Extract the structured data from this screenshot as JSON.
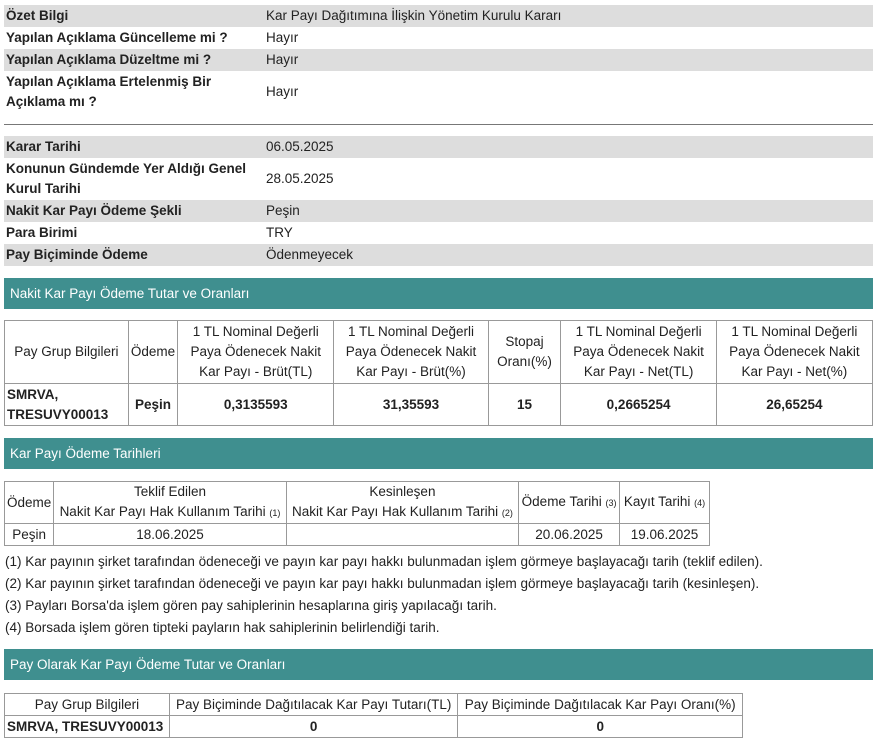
{
  "summary": [
    {
      "key": "Özet Bilgi",
      "value": "Kar Payı Dağıtımına İlişkin Yönetim Kurulu Kararı"
    },
    {
      "key": "Yapılan Açıklama Güncelleme mi ?",
      "value": "Hayır"
    },
    {
      "key": "Yapılan Açıklama Düzeltme mi ?",
      "value": "Hayır"
    },
    {
      "key": "Yapılan Açıklama Ertelenmiş Bir Açıklama mı ?",
      "value": "Hayır"
    }
  ],
  "details": [
    {
      "key": "Karar Tarihi",
      "value": "06.05.2025"
    },
    {
      "key": "Konunun Gündemde Yer Aldığı Genel Kurul Tarihi",
      "value": "28.05.2025"
    },
    {
      "key": "Nakit Kar Payı Ödeme Şekli",
      "value": "Peşin"
    },
    {
      "key": "Para Birimi",
      "value": "TRY"
    },
    {
      "key": "Pay Biçiminde Ödeme",
      "value": "Ödenmeyecek"
    }
  ],
  "cash_section": {
    "title": "Nakit Kar Payı Ödeme Tutar ve Oranları",
    "headers": [
      "Pay Grup Bilgileri",
      "Ödeme",
      "1 TL Nominal Değerli Paya Ödenecek Nakit Kar Payı - Brüt(TL)",
      "1 TL Nominal Değerli Paya Ödenecek Nakit Kar Payı - Brüt(%)",
      "Stopaj Oranı(%)",
      "1 TL Nominal Değerli Paya Ödenecek Nakit Kar Payı - Net(TL)",
      "1 TL Nominal Değerli Paya Ödenecek Nakit Kar Payı - Net(%)"
    ],
    "row": {
      "group": "SMRVA, TRESUVY00013",
      "payment": "Peşin",
      "gross_tl": "0,3135593",
      "gross_pct": "31,35593",
      "withholding": "15",
      "net_tl": "0,2665254",
      "net_pct": "26,65254"
    }
  },
  "dates_section": {
    "title": "Kar Payı Ödeme Tarihleri",
    "h_odeme": "Ödeme",
    "h_teklif_1": "Teklif Edilen",
    "h_teklif_2": "Nakit Kar Payı Hak Kullanım Tarihi",
    "h_teklif_n": "(1)",
    "h_kesin_1": "Kesinleşen",
    "h_kesin_2": "Nakit Kar Payı Hak Kullanım Tarihi",
    "h_kesin_n": "(2)",
    "h_odeme_tarihi": "Ödeme Tarihi",
    "h_odeme_tarihi_n": "(3)",
    "h_kayit": "Kayıt Tarihi",
    "h_kayit_n": "(4)",
    "row": {
      "payment": "Peşin",
      "proposed": "18.06.2025",
      "final": "",
      "pay_date": "20.06.2025",
      "record_date": "19.06.2025"
    },
    "notes": [
      "(1) Kar payının şirket tarafından ödeneceği ve payın kar payı hakkı bulunmadan işlem görmeye başlayacağı tarih (teklif edilen).",
      "(2) Kar payının şirket tarafından ödeneceği ve payın kar payı hakkı bulunmadan işlem görmeye başlayacağı tarih (kesinleşen).",
      "(3) Payları Borsa'da işlem gören pay sahiplerinin hesaplarına giriş yapılacağı tarih.",
      "(4) Borsada işlem gören tipteki payların hak sahiplerinin belirlendiği tarih."
    ]
  },
  "share_section": {
    "title": "Pay Olarak Kar Payı Ödeme Tutar ve Oranları",
    "headers": [
      "Pay Grup Bilgileri",
      "Pay Biçiminde Dağıtılacak Kar Payı Tutarı(TL)",
      "Pay Biçiminde Dağıtılacak Kar Payı Oranı(%)"
    ],
    "row": {
      "group": "SMRVA, TRESUVY00013",
      "amount": "0",
      "ratio": "0"
    }
  },
  "colors": {
    "section_bar": "#3f8f8f",
    "row_shade": "#dddddd"
  }
}
